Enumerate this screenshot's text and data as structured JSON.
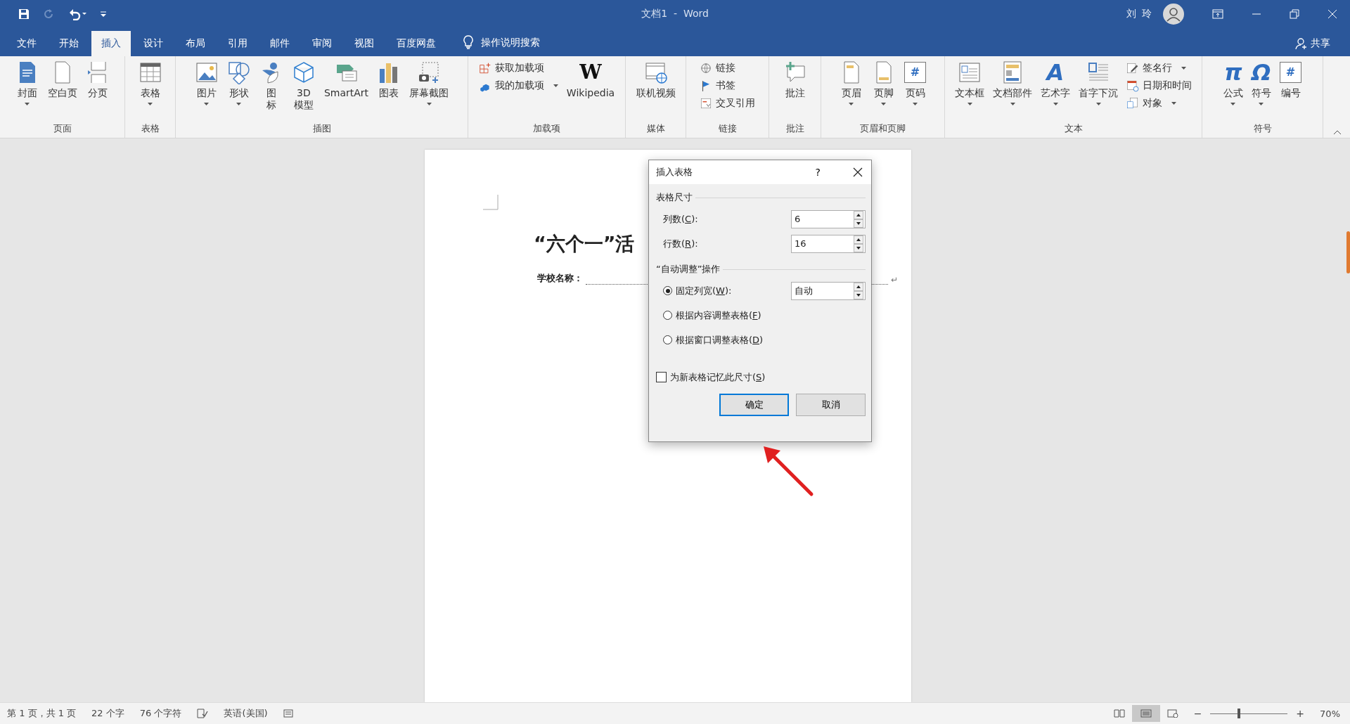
{
  "title_bar": {
    "quick_access": [
      {
        "kind": "save",
        "disabled": false
      },
      {
        "kind": "redo",
        "disabled": true
      },
      {
        "kind": "undo",
        "disabled": false
      },
      {
        "kind": "customize",
        "disabled": false
      }
    ],
    "title": "文档1  -  Word",
    "user": "刘 玲"
  },
  "tabs": [
    {
      "label": "文件",
      "selected": false
    },
    {
      "label": "开始",
      "selected": false
    },
    {
      "label": "插入",
      "selected": true
    },
    {
      "label": "设计",
      "selected": false
    },
    {
      "label": "布局",
      "selected": false
    },
    {
      "label": "引用",
      "selected": false
    },
    {
      "label": "邮件",
      "selected": false
    },
    {
      "label": "审阅",
      "selected": false
    },
    {
      "label": "视图",
      "selected": false
    },
    {
      "label": "百度网盘",
      "selected": false
    }
  ],
  "tell_me": "操作说明搜索",
  "share": "共享",
  "ribbon": {
    "groups": [
      {
        "label": "页面",
        "items": [
          {
            "kind": "large",
            "lines": [
              "封面"
            ],
            "dropdown": true
          },
          {
            "kind": "large",
            "lines": [
              "空白页"
            ],
            "dropdown": false
          },
          {
            "kind": "large",
            "lines": [
              "分页"
            ],
            "dropdown": false
          }
        ]
      },
      {
        "label": "表格",
        "items": [
          {
            "kind": "large",
            "lines": [
              "表格"
            ],
            "dropdown": true
          }
        ]
      },
      {
        "label": "插图",
        "items": [
          {
            "kind": "large",
            "lines": [
              "图片"
            ],
            "dropdown": true
          },
          {
            "kind": "large",
            "lines": [
              "形状"
            ],
            "dropdown": true
          },
          {
            "kind": "large",
            "lines": [
              "图",
              "标"
            ],
            "dropdown": false
          },
          {
            "kind": "large",
            "lines": [
              "3D",
              "模型"
            ],
            "dropdown": false
          },
          {
            "kind": "large",
            "lines": [
              "SmartArt"
            ],
            "dropdown": false
          },
          {
            "kind": "large",
            "lines": [
              "图表"
            ],
            "dropdown": false
          },
          {
            "kind": "large",
            "lines": [
              "屏幕截图"
            ],
            "dropdown": true
          }
        ]
      },
      {
        "label": "加载项",
        "items": [
          {
            "kind": "small",
            "label": "获取加载项",
            "dropdown": false
          },
          {
            "kind": "small",
            "label": "我的加载项",
            "dropdown": true
          },
          {
            "kind": "large",
            "lines": [
              "Wikipedia"
            ],
            "glyph": "W",
            "dropdown": false
          }
        ]
      },
      {
        "label": "媒体",
        "items": [
          {
            "kind": "large",
            "lines": [
              "联机视频"
            ],
            "dropdown": false
          }
        ]
      },
      {
        "label": "链接",
        "items": [
          {
            "kind": "small",
            "label": "链接",
            "dropdown": false
          },
          {
            "kind": "small",
            "label": "书签",
            "dropdown": false
          },
          {
            "kind": "small",
            "label": "交叉引用",
            "dropdown": false
          }
        ]
      },
      {
        "label": "批注",
        "items": [
          {
            "kind": "large",
            "lines": [
              "批注"
            ],
            "dropdown": false
          }
        ]
      },
      {
        "label": "页眉和页脚",
        "items": [
          {
            "kind": "large",
            "lines": [
              "页眉"
            ],
            "dropdown": true
          },
          {
            "kind": "large",
            "lines": [
              "页脚"
            ],
            "dropdown": true
          },
          {
            "kind": "large",
            "lines": [
              "页码"
            ],
            "glyph": "#",
            "dropdown": true
          }
        ]
      },
      {
        "label": "文本",
        "items": [
          {
            "kind": "large",
            "lines": [
              "文本框"
            ],
            "dropdown": true
          },
          {
            "kind": "large",
            "lines": [
              "文档部件"
            ],
            "dropdown": true
          },
          {
            "kind": "large",
            "lines": [
              "艺术字"
            ],
            "glyph": "A",
            "dropdown": true
          },
          {
            "kind": "large",
            "lines": [
              "首字下沉"
            ],
            "dropdown": true
          },
          {
            "kind": "small",
            "label": "签名行",
            "dropdown": true
          },
          {
            "kind": "small",
            "label": "日期和时间",
            "dropdown": false
          },
          {
            "kind": "small",
            "label": "对象",
            "dropdown": true
          }
        ]
      },
      {
        "label": "符号",
        "items": [
          {
            "kind": "large",
            "lines": [
              "公式"
            ],
            "glyph": "π",
            "dropdown": true
          },
          {
            "kind": "large",
            "lines": [
              "符号"
            ],
            "glyph": "Ω",
            "dropdown": true
          },
          {
            "kind": "large",
            "lines": [
              "编号"
            ],
            "glyph": "#",
            "dropdown": false
          }
        ]
      }
    ]
  },
  "document": {
    "heading": "“六个一”活",
    "field_label": "学校名称：",
    "paragraph_mark": "↵"
  },
  "dialog": {
    "title": "插入表格",
    "help": "?",
    "size_section": "表格尺寸",
    "columns": {
      "label": "列数(C):",
      "value": "6"
    },
    "rows": {
      "label": "行数(R):",
      "value": "16"
    },
    "autofit_section": "“自动调整”操作",
    "autofit_options": [
      {
        "label": "固定列宽(W):",
        "selected": true,
        "value": "自动"
      },
      {
        "label": "根据内容调整表格(F)",
        "selected": false
      },
      {
        "label": "根据窗口调整表格(D)",
        "selected": false
      }
    ],
    "remember": {
      "label": "为新表格记忆此尺寸(S)",
      "checked": false
    },
    "buttons": [
      {
        "label": "确定",
        "default": true
      },
      {
        "label": "取消",
        "default": false
      }
    ]
  },
  "status_bar": {
    "page": "第 1 页，共 1 页",
    "words": "22 个字",
    "chars": "76 个字符",
    "language": "英语(美国)",
    "views": [
      {
        "kind": "read",
        "selected": false
      },
      {
        "kind": "print",
        "selected": true
      },
      {
        "kind": "web",
        "selected": false
      }
    ],
    "zoom": {
      "minus": "−",
      "plus": "+",
      "level": 0.35,
      "percent": "70%"
    }
  }
}
